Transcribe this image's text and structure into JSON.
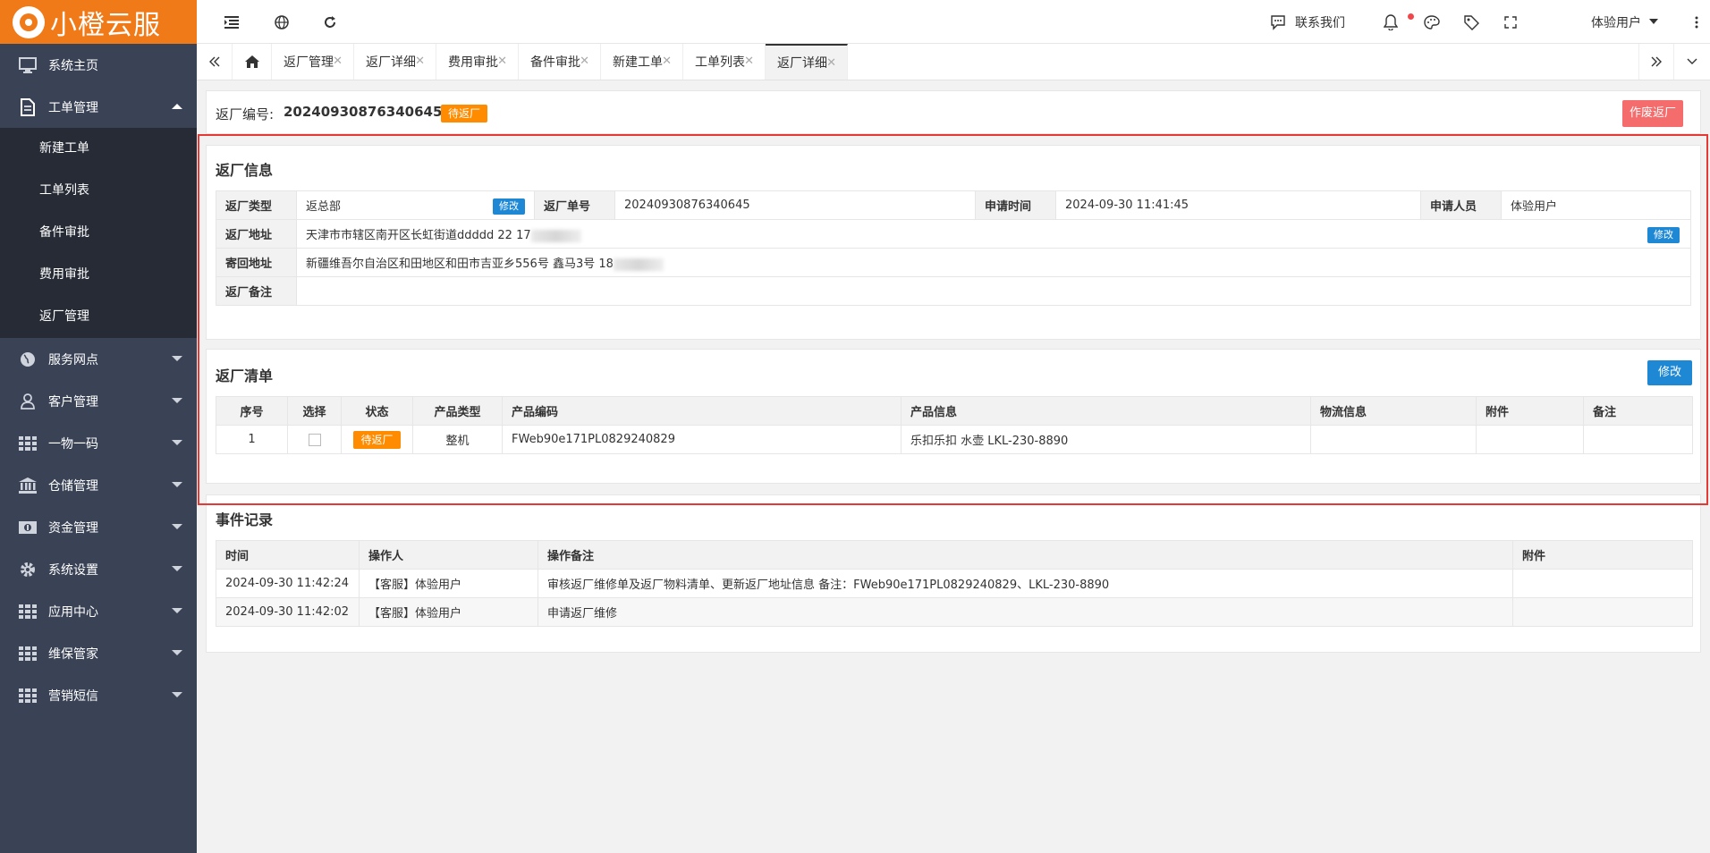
{
  "brand": {
    "name": "小橙云服",
    "accent": "#f07a18",
    "sidebar_bg": "#3a4256",
    "submenu_bg": "#262b36"
  },
  "sidebar": {
    "items": [
      {
        "label": "系统主页",
        "icon": "monitor-icon"
      },
      {
        "label": "工单管理",
        "icon": "document-icon",
        "expanded": true,
        "children": [
          "新建工单",
          "工单列表",
          "备件审批",
          "费用审批",
          "返厂管理"
        ]
      },
      {
        "label": "服务网点",
        "icon": "globe-icon"
      },
      {
        "label": "客户管理",
        "icon": "user-icon"
      },
      {
        "label": "一物一码",
        "icon": "grid-icon"
      },
      {
        "label": "仓储管理",
        "icon": "bank-icon"
      },
      {
        "label": "资金管理",
        "icon": "money-icon"
      },
      {
        "label": "系统设置",
        "icon": "gear-icon"
      },
      {
        "label": "应用中心",
        "icon": "grid-icon"
      },
      {
        "label": "维保管家",
        "icon": "grid-icon"
      },
      {
        "label": "营销短信",
        "icon": "grid-icon"
      }
    ]
  },
  "topbar": {
    "contact": "联系我们",
    "user": "体验用户"
  },
  "tabs": [
    "返厂管理",
    "返厂详细",
    "费用审批",
    "备件审批",
    "新建工单",
    "工单列表",
    "返厂详细"
  ],
  "header": {
    "number_label": "返厂编号:",
    "number": "20240930876340645",
    "status": "待返厂",
    "void_button": "作废返厂"
  },
  "info": {
    "title": "返厂信息",
    "type_label": "返厂类型",
    "type_value": "返总部",
    "edit": "修改",
    "order_label": "返厂单号",
    "order_value": "20240930876340645",
    "time_label": "申请时间",
    "time_value": "2024-09-30 11:41:45",
    "applicant_label": "申请人员",
    "applicant_value": "体验用户",
    "addr_label": "返厂地址",
    "addr_value": "天津市市辖区南开区长虹街道ddddd 22 17",
    "return_label": "寄回地址",
    "return_value": "新疆维吾尔自治区和田地区和田市吉亚乡556号 鑫马3号 18",
    "note_label": "返厂备注",
    "note_value": ""
  },
  "list": {
    "title": "返厂清单",
    "edit": "修改",
    "headers": [
      "序号",
      "选择",
      "状态",
      "产品类型",
      "产品编码",
      "产品信息",
      "物流信息",
      "附件",
      "备注"
    ],
    "rows": [
      {
        "idx": "1",
        "status": "待返厂",
        "type": "整机",
        "code": "FWeb90e171PL0829240829",
        "info": "乐扣乐扣 水壶 LKL-230-8890",
        "logistics": "",
        "attach": "",
        "note": ""
      }
    ]
  },
  "events": {
    "title": "事件记录",
    "headers": [
      "时间",
      "操作人",
      "操作备注",
      "附件"
    ],
    "rows": [
      {
        "time": "2024-09-30 11:42:24",
        "operator": "【客服】体验用户",
        "note": "审核返厂维修单及返厂物料清单、更新返厂地址信息 备注：FWeb90e171PL0829240829、LKL-230-8890",
        "attach": ""
      },
      {
        "time": "2024-09-30 11:42:02",
        "operator": "【客服】体验用户",
        "note": "申请返厂维修",
        "attach": ""
      }
    ]
  }
}
